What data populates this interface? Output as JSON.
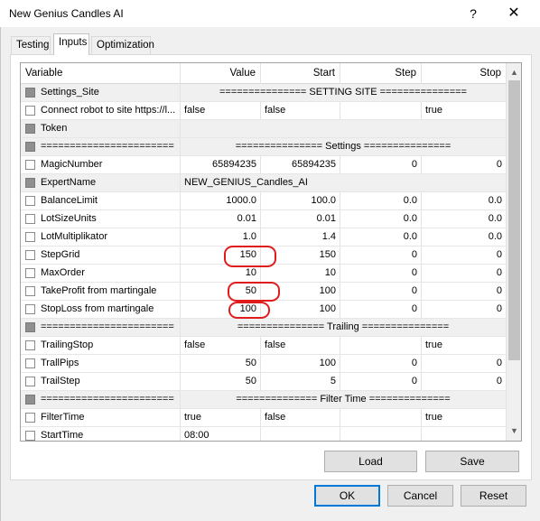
{
  "window": {
    "title": "New Genius Candles AI",
    "help_glyph": "?",
    "close_glyph": "✕"
  },
  "tabs": [
    {
      "label": "Testing"
    },
    {
      "label": "Inputs"
    },
    {
      "label": "Optimization"
    }
  ],
  "grid": {
    "headers": {
      "variable": "Variable",
      "value": "Value",
      "start": "Start",
      "step": "Step",
      "stop": "Stop"
    },
    "rows": [
      {
        "checkbox": "disabled",
        "name": "Settings_Site",
        "span": "=============== SETTING SITE ==============="
      },
      {
        "checkbox": "enabled",
        "name": "Connect robot to site https://l...",
        "value": "false",
        "start": "false",
        "step": "",
        "stop": "true"
      },
      {
        "checkbox": "disabled",
        "name": "Token",
        "span": ""
      },
      {
        "checkbox": "disabled",
        "name": "=======================",
        "span": "=============== Settings ==============="
      },
      {
        "checkbox": "enabled",
        "name": "MagicNumber",
        "value": "65894235",
        "start": "65894235",
        "step": "0",
        "stop": "0"
      },
      {
        "checkbox": "disabled",
        "name": "ExpertName",
        "span": "NEW_GENIUS_Candles_AI"
      },
      {
        "checkbox": "enabled",
        "name": "BalanceLimit",
        "value": "1000.0",
        "start": "100.0",
        "step": "0.0",
        "stop": "0.0"
      },
      {
        "checkbox": "enabled",
        "name": "LotSizeUnits",
        "value": "0.01",
        "start": "0.01",
        "step": "0.0",
        "stop": "0.0"
      },
      {
        "checkbox": "enabled",
        "name": "LotMultiplikator",
        "value": "1.0",
        "start": "1.4",
        "step": "0.0",
        "stop": "0.0"
      },
      {
        "checkbox": "enabled",
        "name": "StepGrid",
        "value": "150",
        "start": "150",
        "step": "0",
        "stop": "0"
      },
      {
        "checkbox": "enabled",
        "name": "MaxOrder",
        "value": "10",
        "start": "10",
        "step": "0",
        "stop": "0"
      },
      {
        "checkbox": "enabled",
        "name": "TakeProfit from martingale",
        "value": "50",
        "start": "100",
        "step": "0",
        "stop": "0"
      },
      {
        "checkbox": "enabled",
        "name": "StopLoss from martingale",
        "value": "100",
        "start": "100",
        "step": "0",
        "stop": "0"
      },
      {
        "checkbox": "disabled",
        "name": "=======================",
        "span": "=============== Trailing ==============="
      },
      {
        "checkbox": "enabled",
        "name": "TrailingStop",
        "value": "false",
        "start": "false",
        "step": "",
        "stop": "true"
      },
      {
        "checkbox": "enabled",
        "name": "TrallPips",
        "value": "50",
        "start": "100",
        "step": "0",
        "stop": "0"
      },
      {
        "checkbox": "enabled",
        "name": "TrailStep",
        "value": "50",
        "start": "5",
        "step": "0",
        "stop": "0"
      },
      {
        "checkbox": "disabled",
        "name": "=======================",
        "span": "============== Filter Time =============="
      },
      {
        "checkbox": "enabled",
        "name": "FilterTime",
        "value": "true",
        "start": "false",
        "step": "",
        "stop": "true"
      },
      {
        "checkbox": "enabled",
        "name": "StartTime",
        "value": "08:00",
        "start": "",
        "step": "",
        "stop": ""
      }
    ]
  },
  "scrollbar": {
    "up_glyph": "▲",
    "down_glyph": "▼"
  },
  "buttons": {
    "load": "Load",
    "save": "Save",
    "ok": "OK",
    "cancel": "Cancel",
    "reset": "Reset"
  },
  "colors": {
    "annotation": "#e01c1c",
    "default_button_border": "#0078d7",
    "shaded_row": "#f0f0f0"
  }
}
